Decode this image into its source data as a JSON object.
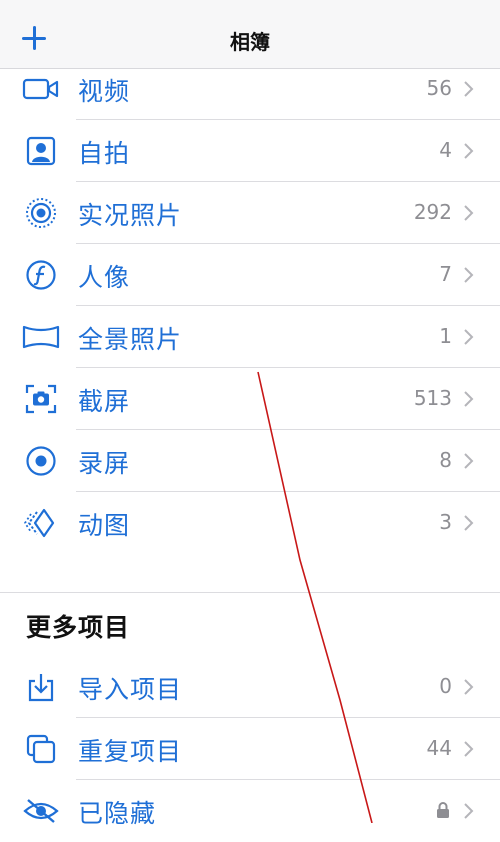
{
  "nav": {
    "title": "相簿"
  },
  "media_types": [
    {
      "label": "视频",
      "count": "56",
      "icon": "video-icon"
    },
    {
      "label": "自拍",
      "count": "4",
      "icon": "selfie-icon"
    },
    {
      "label": "实况照片",
      "count": "292",
      "icon": "live-photo-icon"
    },
    {
      "label": "人像",
      "count": "7",
      "icon": "portrait-icon"
    },
    {
      "label": "全景照片",
      "count": "1",
      "icon": "panorama-icon"
    },
    {
      "label": "截屏",
      "count": "513",
      "icon": "screenshot-icon"
    },
    {
      "label": "录屏",
      "count": "8",
      "icon": "screen-recording-icon"
    },
    {
      "label": "动图",
      "count": "3",
      "icon": "animated-icon"
    }
  ],
  "more_section": {
    "title": "更多项目",
    "items": [
      {
        "label": "导入项目",
        "count": "0",
        "icon": "import-icon"
      },
      {
        "label": "重复项目",
        "count": "44",
        "icon": "duplicates-icon"
      },
      {
        "label": "已隐藏",
        "count": "",
        "icon": "hidden-icon",
        "locked": true
      }
    ]
  },
  "colors": {
    "accent": "#1f6fd6",
    "secondary_text": "#8e8e93"
  }
}
